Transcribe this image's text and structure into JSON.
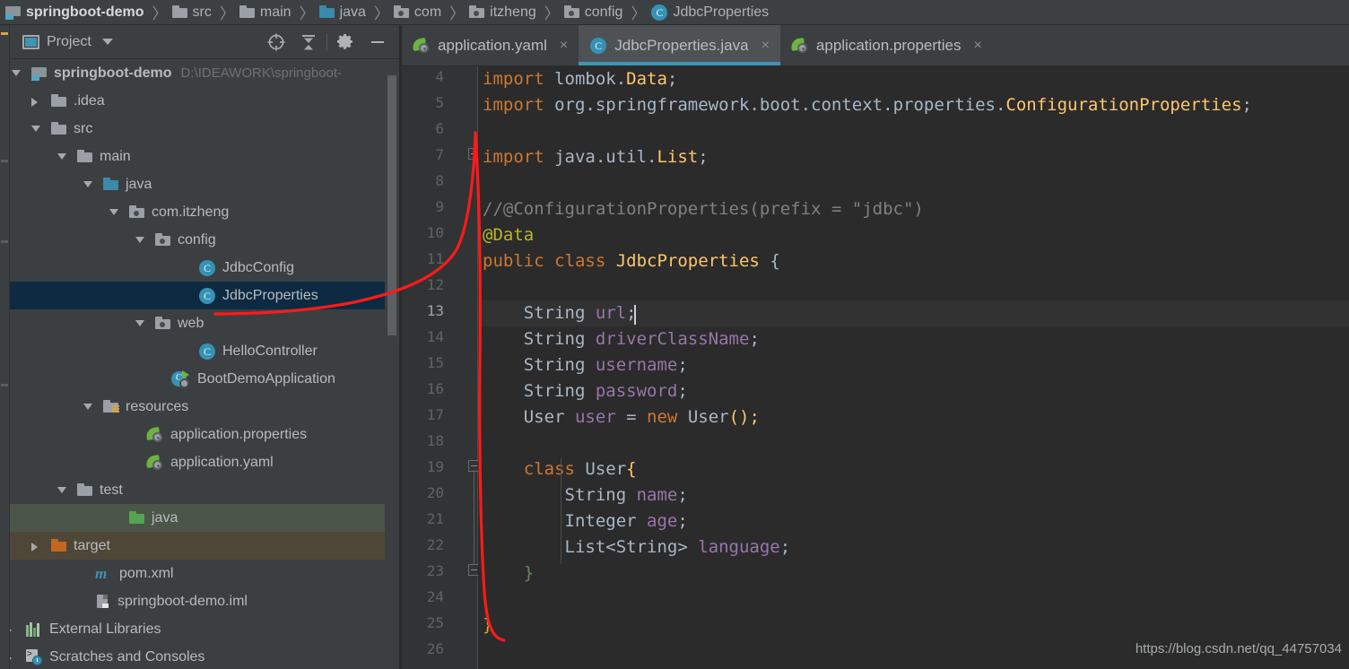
{
  "breadcrumb": {
    "name": "breadcrumb",
    "items": [
      {
        "label": "springboot-demo",
        "icon": "module-icon",
        "root": true
      },
      {
        "label": "src",
        "icon": "folder-icon"
      },
      {
        "label": "main",
        "icon": "folder-icon"
      },
      {
        "label": "java",
        "icon": "folder-blue-icon"
      },
      {
        "label": "com",
        "icon": "package-icon"
      },
      {
        "label": "itzheng",
        "icon": "package-icon"
      },
      {
        "label": "config",
        "icon": "package-icon"
      },
      {
        "label": "JdbcProperties",
        "icon": "class-icon"
      }
    ],
    "separator": "〉"
  },
  "project_panel": {
    "title": "Project",
    "toolbar": [
      {
        "name": "select-opened-file-button",
        "icon": "target-icon"
      },
      {
        "name": "collapse-all-button",
        "icon": "collapse-all-icon"
      },
      {
        "name": "settings-button",
        "icon": "gear-icon"
      },
      {
        "name": "hide-button",
        "icon": "minimize-icon"
      }
    ],
    "tree": [
      {
        "label": "springboot-demo",
        "sub": "D:\\IDEAWORK\\springboot-",
        "icon": "module-icon",
        "arrow": "open",
        "indent": 24,
        "bold": true
      },
      {
        "label": ".idea",
        "icon": "folder-icon",
        "arrow": "closed",
        "indent": 46
      },
      {
        "label": "src",
        "icon": "folder-icon",
        "arrow": "open",
        "indent": 46
      },
      {
        "label": "main",
        "icon": "folder-icon",
        "arrow": "open",
        "indent": 75
      },
      {
        "label": "java",
        "icon": "folder-blue-icon",
        "arrow": "open",
        "indent": 104
      },
      {
        "label": "com.itzheng",
        "icon": "package-icon",
        "arrow": "open",
        "indent": 133
      },
      {
        "label": "config",
        "icon": "package-icon",
        "arrow": "open",
        "indent": 162
      },
      {
        "label": "JdbcConfig",
        "icon": "class-icon",
        "indent": 210
      },
      {
        "label": "JdbcProperties",
        "icon": "class-icon",
        "indent": 210,
        "state": "selected"
      },
      {
        "label": "web",
        "icon": "package-icon",
        "arrow": "open",
        "indent": 162
      },
      {
        "label": "HelloController",
        "icon": "class-icon",
        "indent": 210
      },
      {
        "label": "BootDemoApplication",
        "icon": "spring-app-icon",
        "indent": 180
      },
      {
        "label": "resources",
        "icon": "resources-folder-icon",
        "arrow": "open",
        "indent": 104
      },
      {
        "label": "application.properties",
        "icon": "spring-file-icon",
        "indent": 152
      },
      {
        "label": "application.yaml",
        "icon": "spring-file-icon",
        "indent": 152
      },
      {
        "label": "test",
        "icon": "folder-icon",
        "arrow": "open",
        "indent": 75
      },
      {
        "label": "java",
        "icon": "folder-green-icon",
        "indent": 133,
        "state": "tint-green"
      },
      {
        "label": "target",
        "icon": "folder-orange-icon",
        "arrow": "closed",
        "indent": 46,
        "state": "tint-brown"
      },
      {
        "label": "pom.xml",
        "icon": "maven-icon",
        "indent": 95
      },
      {
        "label": "springboot-demo.iml",
        "icon": "iml-icon",
        "indent": 95
      },
      {
        "label": "External Libraries",
        "icon": "library-icon",
        "arrow": "closed",
        "indent": 17
      },
      {
        "label": "Scratches and Consoles",
        "icon": "scratches-icon",
        "arrow": "closed",
        "indent": 17
      }
    ]
  },
  "editor": {
    "tabs": [
      {
        "label": "application.yaml",
        "icon": "spring-file-icon",
        "active": false,
        "close": "×"
      },
      {
        "label": "JdbcProperties.java",
        "icon": "class-icon",
        "active": true,
        "close": "×"
      },
      {
        "label": "application.properties",
        "icon": "spring-file-icon",
        "active": false,
        "close": "×"
      }
    ],
    "active_line": 13,
    "first_line": 4,
    "last_line": 26,
    "line_numbers": [
      4,
      5,
      6,
      7,
      8,
      9,
      10,
      11,
      12,
      13,
      14,
      15,
      16,
      17,
      18,
      19,
      20,
      21,
      22,
      23,
      24,
      25,
      26
    ],
    "lines": [
      {
        "n": 4,
        "tokens": [
          {
            "t": "import ",
            "c": "kw"
          },
          {
            "t": "lombok.",
            "c": "plain"
          },
          {
            "t": "Data",
            "c": "cls"
          },
          {
            "t": ";",
            "c": "plain"
          }
        ]
      },
      {
        "n": 5,
        "tokens": [
          {
            "t": "import ",
            "c": "kw"
          },
          {
            "t": "org.springframework.boot.context.properties.",
            "c": "plain"
          },
          {
            "t": "ConfigurationProperties",
            "c": "cls"
          },
          {
            "t": ";",
            "c": "plain"
          }
        ]
      },
      {
        "n": 6,
        "tokens": []
      },
      {
        "n": 7,
        "tokens": [
          {
            "t": "import ",
            "c": "kw"
          },
          {
            "t": "java.util.",
            "c": "plain"
          },
          {
            "t": "List",
            "c": "cls"
          },
          {
            "t": ";",
            "c": "plain"
          }
        ]
      },
      {
        "n": 8,
        "tokens": []
      },
      {
        "n": 9,
        "tokens": [
          {
            "t": "//@ConfigurationProperties(prefix = \"jdbc\")",
            "c": "comment"
          }
        ]
      },
      {
        "n": 10,
        "tokens": [
          {
            "t": "@Data",
            "c": "anno"
          }
        ]
      },
      {
        "n": 11,
        "tokens": [
          {
            "t": "public ",
            "c": "kw"
          },
          {
            "t": "class ",
            "c": "kw"
          },
          {
            "t": "JdbcProperties",
            "c": "cls"
          },
          {
            "t": " {",
            "c": "plain"
          }
        ]
      },
      {
        "n": 12,
        "tokens": []
      },
      {
        "n": 13,
        "tokens": [
          {
            "t": "    String ",
            "c": "plain"
          },
          {
            "t": "url",
            "c": "field"
          },
          {
            "t": ";",
            "c": "plain"
          }
        ]
      },
      {
        "n": 14,
        "tokens": [
          {
            "t": "    String ",
            "c": "plain"
          },
          {
            "t": "driverClassName",
            "c": "field"
          },
          {
            "t": ";",
            "c": "plain"
          }
        ]
      },
      {
        "n": 15,
        "tokens": [
          {
            "t": "    String ",
            "c": "plain"
          },
          {
            "t": "username",
            "c": "field"
          },
          {
            "t": ";",
            "c": "plain"
          }
        ]
      },
      {
        "n": 16,
        "tokens": [
          {
            "t": "    String ",
            "c": "plain"
          },
          {
            "t": "password",
            "c": "field"
          },
          {
            "t": ";",
            "c": "plain"
          }
        ]
      },
      {
        "n": 17,
        "tokens": [
          {
            "t": "    User ",
            "c": "plain"
          },
          {
            "t": "user",
            "c": "field"
          },
          {
            "t": " = ",
            "c": "plain"
          },
          {
            "t": "new ",
            "c": "kw"
          },
          {
            "t": "User",
            "c": "plain"
          },
          {
            "t": "();",
            "c": "cls"
          }
        ]
      },
      {
        "n": 18,
        "tokens": []
      },
      {
        "n": 19,
        "tokens": [
          {
            "t": "    ",
            "c": "plain"
          },
          {
            "t": "class ",
            "c": "kw"
          },
          {
            "t": "User",
            "c": "plain"
          },
          {
            "t": "{",
            "c": "cls"
          }
        ]
      },
      {
        "n": 20,
        "tokens": [
          {
            "t": "        String ",
            "c": "plain"
          },
          {
            "t": "name",
            "c": "field"
          },
          {
            "t": ";",
            "c": "plain"
          }
        ]
      },
      {
        "n": 21,
        "tokens": [
          {
            "t": "        Integer ",
            "c": "plain"
          },
          {
            "t": "age",
            "c": "field"
          },
          {
            "t": ";",
            "c": "plain"
          }
        ]
      },
      {
        "n": 22,
        "tokens": [
          {
            "t": "        List<String> ",
            "c": "plain"
          },
          {
            "t": "language",
            "c": "field"
          },
          {
            "t": ";",
            "c": "plain"
          }
        ]
      },
      {
        "n": 23,
        "tokens": [
          {
            "t": "    }",
            "c": "string"
          }
        ]
      },
      {
        "n": 24,
        "tokens": []
      },
      {
        "n": 25,
        "tokens": [
          {
            "t": "}",
            "c": "anno"
          }
        ]
      },
      {
        "n": 26,
        "tokens": []
      }
    ]
  },
  "watermark": "https://blog.csdn.net/qq_44757034",
  "colors": {
    "chrome": "#3c3f41",
    "editor_bg": "#2b2b2b",
    "gutter_bg": "#313335",
    "accent": "#3f93b4",
    "selection": "#0d2a42",
    "annotation": "#ff0000",
    "keyword": "#cc7832",
    "field": "#9876aa",
    "class": "#ffc66d",
    "comment": "#808080",
    "annotation_token": "#bbb529",
    "string": "#6a8759",
    "plain": "#a9b7c6"
  }
}
